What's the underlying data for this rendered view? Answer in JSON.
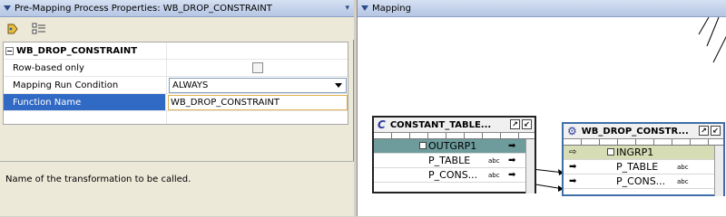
{
  "left_pane": {
    "title": "Pre-Mapping Process Properties: WB_DROP_CONSTRAINT",
    "dock_icon": "pin-icon",
    "toolbar": {
      "sort_icon": "sort-icon",
      "group_icon": "categorize-icon"
    },
    "properties": {
      "group_label": "WB_DROP_CONSTRAINT",
      "rows": [
        {
          "key": "Row-based only",
          "value": ""
        },
        {
          "key": "Mapping Run Condition",
          "value": "ALWAYS"
        },
        {
          "key": "Function Name",
          "value": "WB_DROP_CONSTRAINT"
        }
      ]
    },
    "description": "Name of the transformation to be called."
  },
  "right_pane": {
    "title": "Mapping",
    "operators": [
      {
        "title": "CONSTANT_TABLE...",
        "icon": "C",
        "group": "OUTGRP1",
        "attributes": [
          "P_TABLE",
          "P_CONS..."
        ]
      },
      {
        "title": "WB_DROP_CONSTR...",
        "icon": "transformation-icon",
        "group": "INGRP1",
        "attributes": [
          "P_TABLE",
          "P_CONS..."
        ]
      }
    ],
    "abc_tag": "abc"
  }
}
